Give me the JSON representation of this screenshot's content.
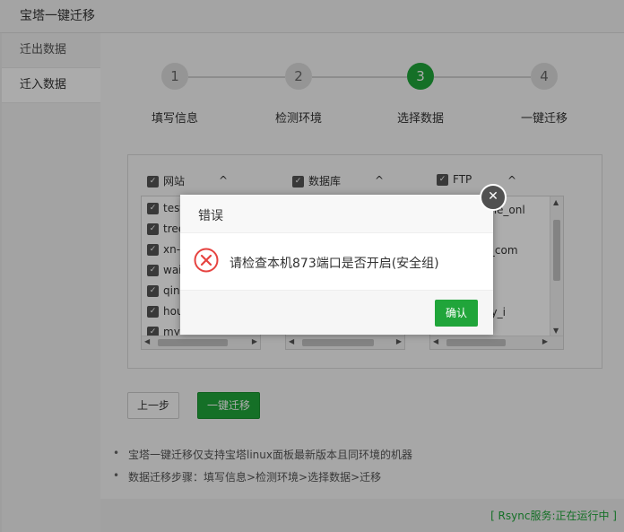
{
  "window": {
    "title": "宝塔一键迁移"
  },
  "sidebar": {
    "items": [
      {
        "label": "迁出数据"
      },
      {
        "label": "迁入数据"
      }
    ]
  },
  "steps": [
    {
      "num": "1",
      "label": "填写信息"
    },
    {
      "num": "2",
      "label": "检测环境"
    },
    {
      "num": "3",
      "label": "选择数据"
    },
    {
      "num": "4",
      "label": "一键迁移"
    }
  ],
  "columns": {
    "site": {
      "header": "网站",
      "rows": [
        "test",
        "tree",
        "xn--",
        "wai",
        "qing",
        "hou",
        "my"
      ]
    },
    "database": {
      "header": "数据库"
    },
    "ftp": {
      "header": "FTP",
      "rows": [
        "egame_onl",
        "oust_com",
        "eesky_i"
      ]
    }
  },
  "buttons": {
    "prev": "上一步",
    "migrate": "一键迁移"
  },
  "notes": [
    "宝塔一键迁移仅支持宝塔linux面板最新版本且同环境的机器",
    "数据迁移步骤：填写信息>检测环境>选择数据>迁移"
  ],
  "status": {
    "text": "[ Rsync服务:正在运行中 ]"
  },
  "dialog": {
    "title": "错误",
    "message": "请检查本机873端口是否开启(安全组)",
    "ok_label": "确认",
    "close_icon": "close-icon",
    "message_icon": "error-icon"
  },
  "colors": {
    "accent": "#20a53a",
    "error": "#e64340"
  }
}
